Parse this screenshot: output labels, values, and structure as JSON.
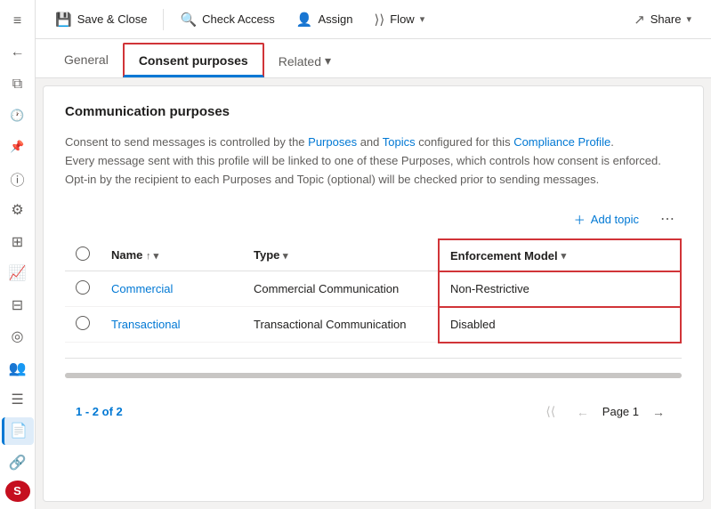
{
  "sidebar": {
    "icons": [
      {
        "name": "hamburger-icon",
        "symbol": "≡"
      },
      {
        "name": "back-icon",
        "symbol": "←"
      },
      {
        "name": "restore-icon",
        "symbol": "⧉"
      },
      {
        "name": "clock-icon",
        "symbol": "🕐"
      },
      {
        "name": "pin-icon",
        "symbol": "📌"
      },
      {
        "name": "info-icon",
        "symbol": "ℹ"
      },
      {
        "name": "gear-icon",
        "symbol": "⚙"
      },
      {
        "name": "chart-icon",
        "symbol": "📊"
      },
      {
        "name": "line-chart-icon",
        "symbol": "📈"
      },
      {
        "name": "grid-icon",
        "symbol": "⊞"
      },
      {
        "name": "circle-icon",
        "symbol": "◎"
      },
      {
        "name": "people-icon",
        "symbol": "👥"
      },
      {
        "name": "list-icon",
        "symbol": "☰"
      },
      {
        "name": "document-icon",
        "symbol": "📄"
      },
      {
        "name": "link-icon",
        "symbol": "🔗"
      },
      {
        "name": "user-icon",
        "symbol": "S"
      }
    ]
  },
  "toolbar": {
    "save_close_label": "Save & Close",
    "check_access_label": "Check Access",
    "assign_label": "Assign",
    "flow_label": "Flow",
    "share_label": "Share"
  },
  "tabs": {
    "general_label": "General",
    "consent_purposes_label": "Consent purposes",
    "related_label": "Related"
  },
  "content": {
    "section_title": "Communication purposes",
    "info_text_1": "Consent to send messages is controlled by the Purposes and Topics configured for this Compliance Profile.",
    "info_text_2": "Every message sent with this profile will be linked to one of these Purposes, which controls how consent is enforced. Opt-in by the recipient to each Purposes and Topic (optional) will be checked prior to sending messages.",
    "add_topic_label": "Add topic",
    "table": {
      "col_radio": "",
      "col_name": "Name",
      "col_type": "Type",
      "col_enforcement": "Enforcement Model",
      "rows": [
        {
          "name": "Commercial",
          "type": "Commercial Communication",
          "enforcement": "Non-Restrictive"
        },
        {
          "name": "Transactional",
          "type": "Transactional Communication",
          "enforcement": "Disabled"
        }
      ]
    },
    "pagination": {
      "range": "1 - 2 of 2",
      "range_highlighted": "1 - 2 of 2",
      "page_label": "Page 1"
    }
  }
}
